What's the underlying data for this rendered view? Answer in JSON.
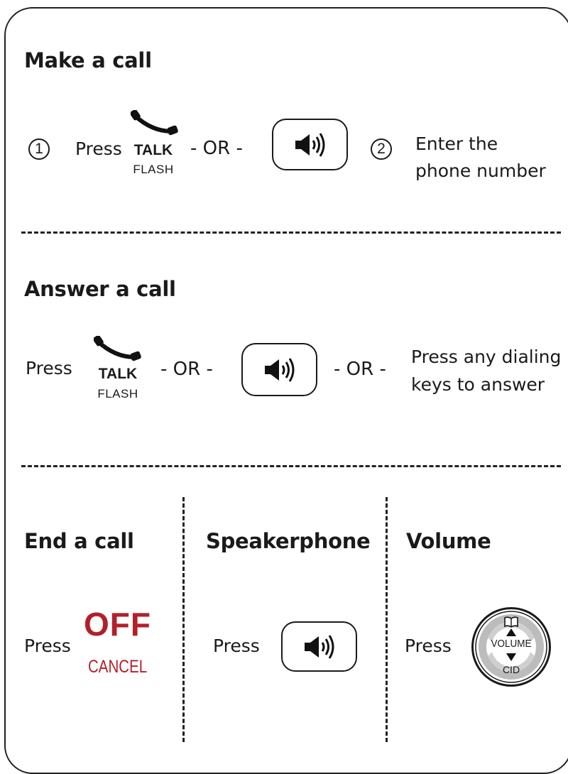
{
  "make_call": {
    "title": "Make a call",
    "step1": "1",
    "press": "Press",
    "talk": "TALK",
    "flash": "FLASH",
    "or": "- OR -",
    "step2": "2",
    "enter_line1": "Enter the",
    "enter_line2": "phone number"
  },
  "answer_call": {
    "title": "Answer a call",
    "press": "Press",
    "talk": "TALK",
    "flash": "FLASH",
    "or1": "- OR -",
    "or2": "- OR -",
    "any_line1": "Press any dialing",
    "any_line2": "keys to answer"
  },
  "end_call": {
    "title": "End a call",
    "press": "Press",
    "off": "OFF",
    "cancel": "CANCEL"
  },
  "speakerphone": {
    "title": "Speakerphone",
    "press": "Press"
  },
  "volume": {
    "title": "Volume",
    "press": "Press",
    "volume_label": "VOLUME",
    "cid_label": "CID"
  },
  "icons": {
    "phone": "phone-handset-icon",
    "speaker": "speaker-icon",
    "phonebook": "phonebook-icon",
    "up": "arrow-up-icon",
    "down": "arrow-down-icon"
  },
  "colors": {
    "accent_red": "#b2202a",
    "text": "#1a1a1a",
    "key_gray": "#bcbcbc"
  }
}
